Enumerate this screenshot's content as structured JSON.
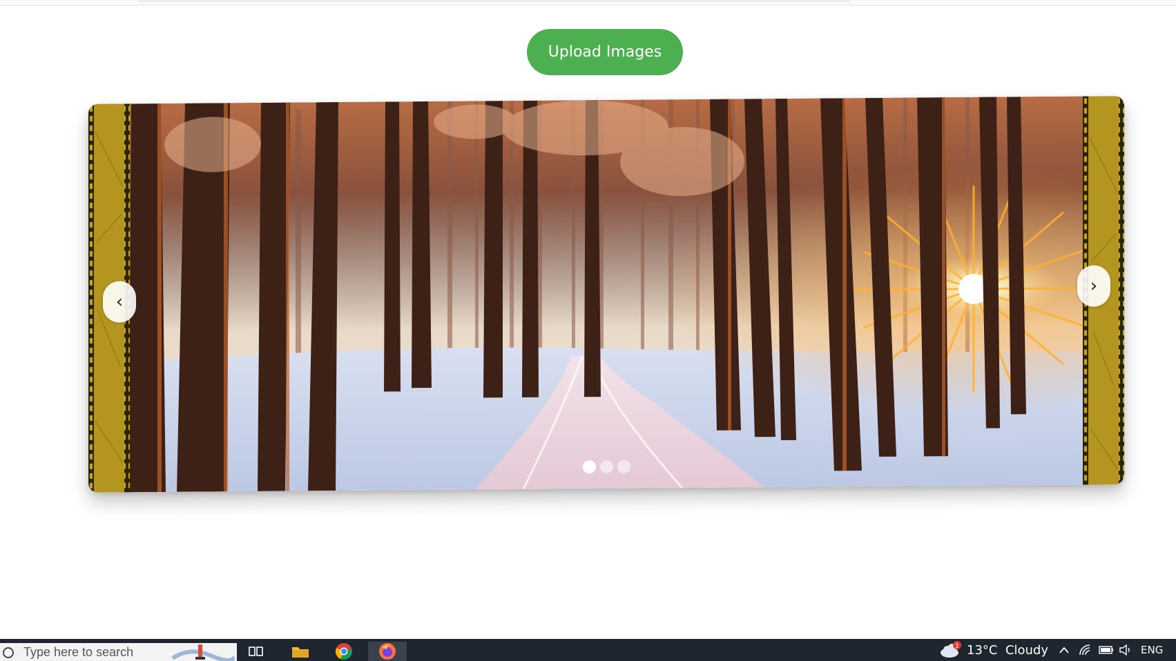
{
  "toolbar": {
    "upload_label": "Upload Images"
  },
  "carousel": {
    "prev_label": "‹",
    "next_label": "›",
    "slide_count": 3,
    "active_slide": 1,
    "slide_description_icon": "snowy-forest-sunset-image"
  },
  "taskbar": {
    "search_placeholder": "Type here to search",
    "apps": [
      "task-view-icon",
      "file-explorer-icon",
      "chrome-icon",
      "firefox-icon"
    ],
    "weather": {
      "temp": "13°C",
      "condition": "Cloudy",
      "alert": "1"
    },
    "language": "ENG"
  },
  "colors": {
    "accent": "#4caf50",
    "frame": "#b3951f",
    "taskbar": "#1f2630"
  }
}
